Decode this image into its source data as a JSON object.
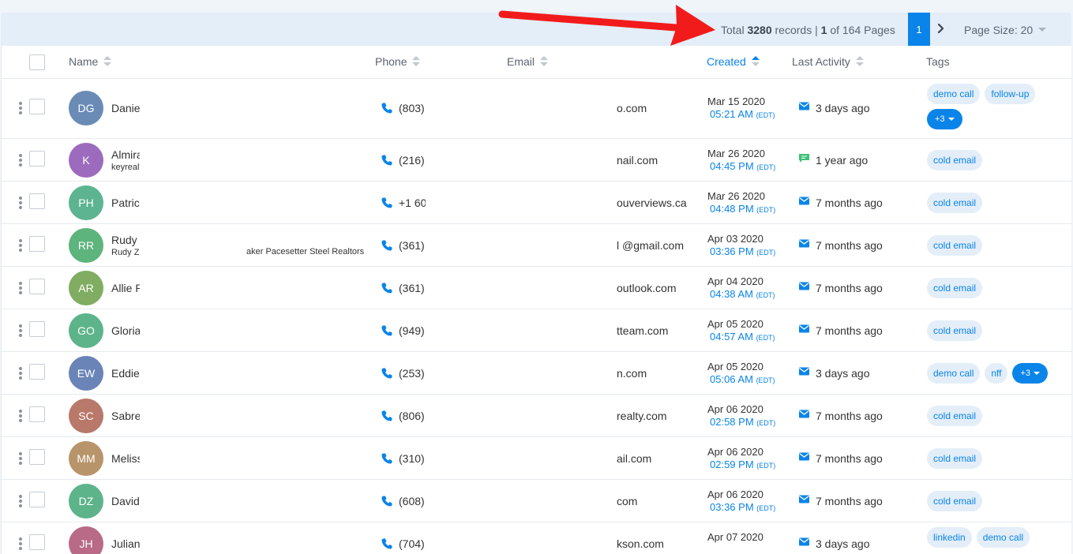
{
  "pagination": {
    "total_prefix": "Total",
    "total_records": "3280",
    "total_mid": "records |",
    "current_page": "1",
    "of_pages": "of 164 Pages",
    "page_button": "1",
    "page_size": "Page Size: 20"
  },
  "columns": {
    "name": "Name",
    "phone": "Phone",
    "email": "Email",
    "created": "Created",
    "last_activity": "Last Activity",
    "tags": "Tags"
  },
  "rows": [
    {
      "initials": "DG",
      "color": "#6a8bb5",
      "name": "Daniel",
      "company": "",
      "company_text": "",
      "phone": "(803)",
      "email": "o.com",
      "date": "Mar 15 2020",
      "time": "05:21 AM",
      "tz": "(EDT)",
      "activity_icon": "mail-icon",
      "activity": "3 days ago",
      "tags": [
        "demo call",
        "follow-up"
      ],
      "more": "+3"
    },
    {
      "initials": "K",
      "color": "#9d6bbd",
      "name": "Almira",
      "company": "keyrealt",
      "company_text": "",
      "phone": "(216)",
      "email": "nail.com",
      "date": "Mar 26 2020",
      "time": "04:45 PM",
      "tz": "(EDT)",
      "activity_icon": "chat-icon",
      "activity": "1 year ago",
      "tags": [
        "cold email"
      ],
      "more": ""
    },
    {
      "initials": "PH",
      "color": "#5db491",
      "name": "Patric",
      "company": "",
      "company_text": "",
      "phone": "+1 60",
      "email": "ouverviews.ca",
      "date": "Mar 26 2020",
      "time": "04:48 PM",
      "tz": "(EDT)",
      "activity_icon": "mail-icon",
      "activity": "7 months ago",
      "tags": [
        "cold email"
      ],
      "more": ""
    },
    {
      "initials": "RR",
      "color": "#5db47d",
      "name": "Rudy Z",
      "company": "Rudy Zu",
      "company_text": "aker Pacesetter Steel Realtors",
      "phone": "(361)",
      "email": "l @gmail.com",
      "date": "Apr 03 2020",
      "time": "03:36 PM",
      "tz": "(EDT)",
      "activity_icon": "mail-icon",
      "activity": "7 months ago",
      "tags": [
        "cold email"
      ],
      "more": ""
    },
    {
      "initials": "AR",
      "color": "#80ad62",
      "name": "Allie R",
      "company": "",
      "company_text": "",
      "phone": "(361)",
      "email": "outlook.com",
      "date": "Apr 04 2020",
      "time": "04:38 AM",
      "tz": "(EDT)",
      "activity_icon": "mail-icon",
      "activity": "7 months ago",
      "tags": [
        "cold email"
      ],
      "more": ""
    },
    {
      "initials": "GO",
      "color": "#5db48a",
      "name": "Gloria",
      "company": "",
      "company_text": "",
      "phone": "(949)",
      "email": "tteam.com",
      "date": "Apr 05 2020",
      "time": "04:57 AM",
      "tz": "(EDT)",
      "activity_icon": "mail-icon",
      "activity": "7 months ago",
      "tags": [
        "cold email"
      ],
      "more": ""
    },
    {
      "initials": "EW",
      "color": "#6a84b8",
      "name": "Eddie",
      "company": "",
      "company_text": "",
      "phone": "(253)",
      "email": "n.com",
      "date": "Apr 05 2020",
      "time": "05:06 AM",
      "tz": "(EDT)",
      "activity_icon": "mail-icon",
      "activity": "3 days ago",
      "tags": [
        "demo call",
        "nff"
      ],
      "more": "+3"
    },
    {
      "initials": "SC",
      "color": "#b8786a",
      "name": "Sabre",
      "company": "",
      "company_text": "",
      "phone": "(806)",
      "email": "realty.com",
      "date": "Apr 06 2020",
      "time": "02:58 PM",
      "tz": "(EDT)",
      "activity_icon": "mail-icon",
      "activity": "7 months ago",
      "tags": [
        "cold email"
      ],
      "more": ""
    },
    {
      "initials": "MM",
      "color": "#b8946a",
      "name": "Meliss",
      "company": "",
      "company_text": "",
      "phone": "(310)",
      "email": "ail.com",
      "date": "Apr 06 2020",
      "time": "02:59 PM",
      "tz": "(EDT)",
      "activity_icon": "mail-icon",
      "activity": "7 months ago",
      "tags": [
        "cold email"
      ],
      "more": ""
    },
    {
      "initials": "DZ",
      "color": "#5db48a",
      "name": "David",
      "company": "",
      "company_text": "",
      "phone": "(608)",
      "email": "com",
      "date": "Apr 06 2020",
      "time": "03:36 PM",
      "tz": "(EDT)",
      "activity_icon": "mail-icon",
      "activity": "7 months ago",
      "tags": [
        "cold email"
      ],
      "more": ""
    },
    {
      "initials": "JH",
      "color": "#b86a86",
      "name": "Julian",
      "company": "",
      "company_text": "",
      "phone": "(704)",
      "email": "kson.com",
      "date": "Apr 07 2020",
      "time": "",
      "tz": "",
      "activity_icon": "mail-icon",
      "activity": "3 days ago",
      "tags": [
        "linkedin",
        "demo call"
      ],
      "more": ""
    }
  ],
  "colors": {
    "accent": "#0a84e8",
    "toolbar_bg": "#e3eef9",
    "tag_bg": "#e3eef9",
    "chat_green": "#3cc27a",
    "annotation_red": "#f21b1b"
  }
}
